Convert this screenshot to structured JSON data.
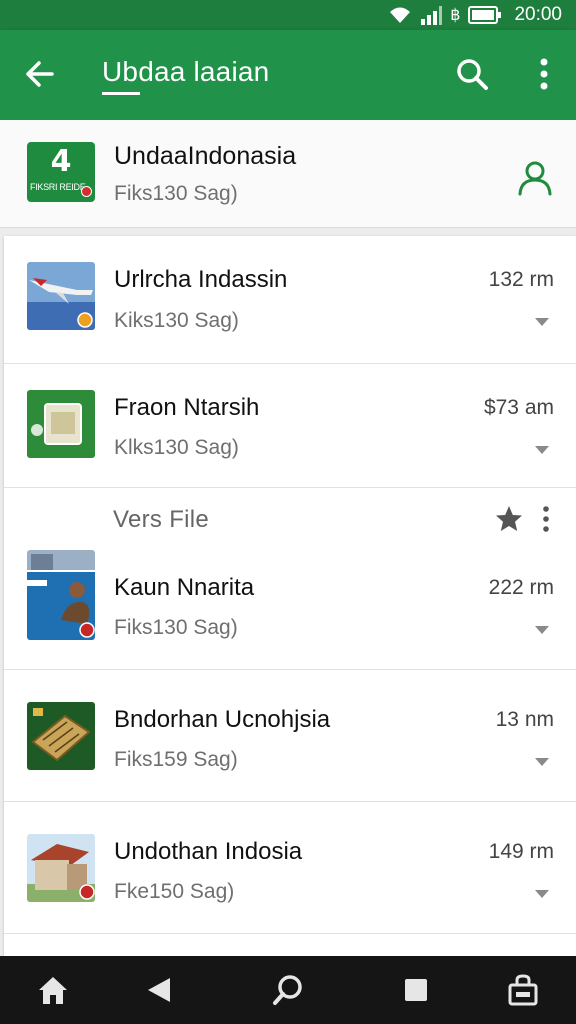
{
  "status_bar": {
    "time": "20:00"
  },
  "app_bar": {
    "title": "Ubdaa laaian"
  },
  "featured": {
    "name": "UndaaIndonasia",
    "subtitle": "Fiks130 Sag)",
    "logo_big": "4",
    "logo_small": "FIKSRI REIDE"
  },
  "list": {
    "items": [
      {
        "title": "Urlrcha Indassin",
        "subtitle": "Kiks130 Sag)",
        "time": "132 rm"
      },
      {
        "title": "Fraon Ntarsih",
        "subtitle": "Klks130 Sag)",
        "time": "$73 am"
      }
    ],
    "section_label": "Vers  File",
    "items2": [
      {
        "title": "Kaun Nnarita",
        "subtitle": "Fiks130 Sag)",
        "time": "222 rm"
      },
      {
        "title": "Bndorhan Ucnohjsia",
        "subtitle": "Fiks159 Sag)",
        "time": "13 nm"
      },
      {
        "title": "Undothan Indosia",
        "subtitle": "Fke150 Sag)",
        "time": "149 rm"
      }
    ]
  },
  "colors": {
    "primary": "#21924a",
    "status_bar": "#1e7e3e",
    "nav_bar": "#151515",
    "icon_green": "#1f8b3f"
  },
  "icons": [
    "wifi-icon",
    "signal-icon",
    "battery-icon",
    "back-arrow-icon",
    "search-icon",
    "more-vert-icon",
    "person-icon",
    "chevron-down-icon",
    "star-icon",
    "home-icon",
    "back-triangle-icon",
    "search-nav-icon",
    "recents-icon",
    "bag-icon"
  ]
}
